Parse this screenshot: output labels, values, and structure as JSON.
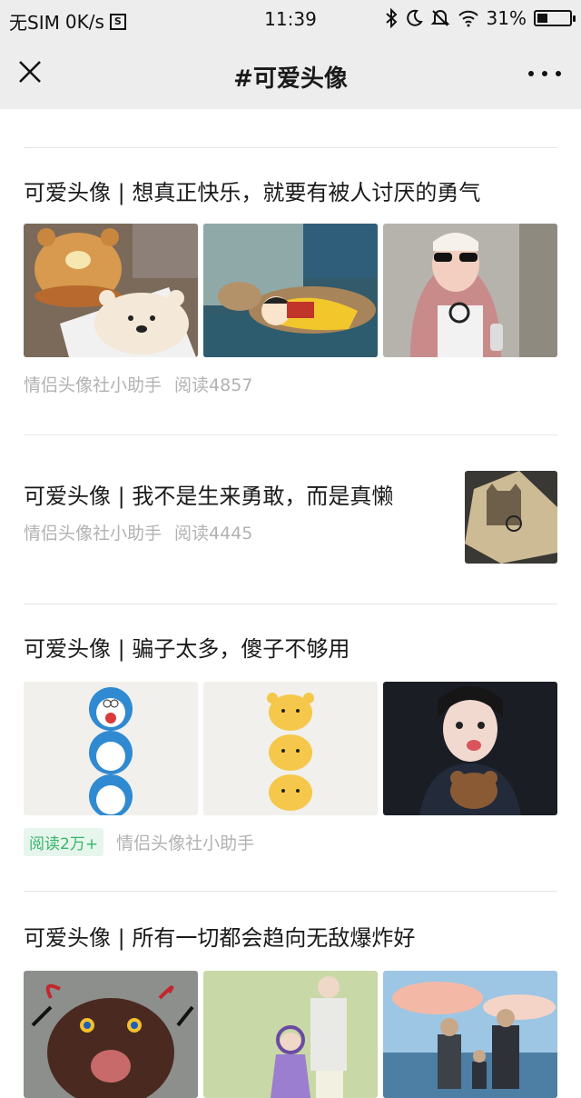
{
  "status_bar": {
    "carrier": "无SIM",
    "speed": "0K/s",
    "sim_icon_letter": "S",
    "time": "11:39",
    "battery_percent": "31%",
    "battery_level": 0.31
  },
  "nav": {
    "title": "#可爱头像",
    "close_icon": "close-icon",
    "more_icon": "more-icon"
  },
  "articles": [
    {
      "title": "可爱头像 | 想真正快乐，就要有被人讨厌的勇气",
      "source": "情侣头像社小助手",
      "reads": "阅读4857",
      "images": [
        "bear-buns-photo",
        "cat-sleeping-photo",
        "girl-sunglasses-photo"
      ]
    },
    {
      "title": "可爱头像 | 我不是生来勇敢，而是真懒",
      "source": "情侣头像社小助手",
      "reads": "阅读4445",
      "images": [
        "shadow-cat-wall-photo"
      ]
    },
    {
      "title": "可爱头像 | 骗子太多，傻子不够用",
      "source": "情侣头像社小助手",
      "reads_badge": "阅读2万+",
      "images": [
        "doraemon-stack-drawing",
        "bear-stack-drawing",
        "girl-teddy-photo"
      ]
    },
    {
      "title": "可爱头像 | 所有一切都会趋向无敌爆炸好",
      "images": [
        "dog-doodle-photo",
        "couple-illustration",
        "family-beach-photo"
      ]
    }
  ],
  "colors": {
    "bar_bg": "#ededed",
    "meta_text": "#b2b2b2",
    "badge_bg": "#e7f6ec",
    "badge_text": "#37b56a"
  }
}
